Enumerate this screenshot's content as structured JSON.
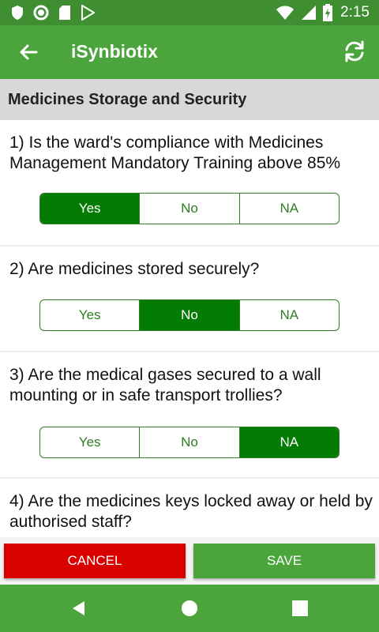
{
  "status_bar": {
    "time": "2:15",
    "icons": [
      "shield-icon",
      "circle-icon",
      "sd-card-icon",
      "play-store-icon",
      "wifi-icon",
      "signal-icon",
      "battery-charging-icon"
    ]
  },
  "app_bar": {
    "title": "iSynbiotix",
    "back_icon": "arrow-left-icon",
    "sync_icon": "sync-icon"
  },
  "section": {
    "title": "Medicines Storage and Security"
  },
  "questions": [
    {
      "text": "1) Is the ward's compliance with Medicines Management Mandatory Training above 85%",
      "options": [
        "Yes",
        "No",
        "NA"
      ],
      "selected": "Yes"
    },
    {
      "text": "2) Are medicines stored securely?",
      "options": [
        "Yes",
        "No",
        "NA"
      ],
      "selected": "No"
    },
    {
      "text": "3) Are the medical gases secured to a wall mounting or in safe transport trollies?",
      "options": [
        "Yes",
        "No",
        "NA"
      ],
      "selected": "NA"
    },
    {
      "text": "4) Are the medicines keys locked away or held by authorised staff?",
      "options": [],
      "selected": ""
    }
  ],
  "actions": {
    "cancel_label": "CANCEL",
    "save_label": "SAVE"
  },
  "colors": {
    "status_bar": "#3f8f32",
    "app_bar": "#4ba43c",
    "selected": "#047c04",
    "cancel": "#d90000",
    "save": "#4ba43c"
  }
}
